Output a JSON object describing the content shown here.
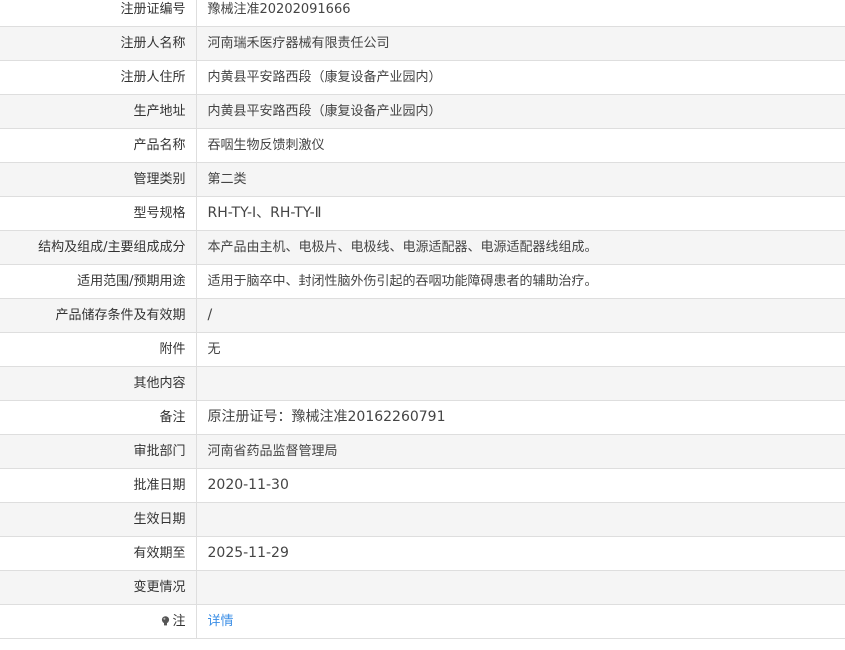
{
  "rows": [
    {
      "label": "注册证编号",
      "value": "豫械注准20202091666"
    },
    {
      "label": "注册人名称",
      "value": "河南瑞禾医疗器械有限责任公司"
    },
    {
      "label": "注册人住所",
      "value": "内黄县平安路西段（康复设备产业园内）"
    },
    {
      "label": "生产地址",
      "value": "内黄县平安路西段（康复设备产业园内）"
    },
    {
      "label": "产品名称",
      "value": "吞咽生物反馈刺激仪"
    },
    {
      "label": "管理类别",
      "value": "第二类"
    },
    {
      "label": "型号规格",
      "value": "RH-TY-Ⅰ、RH-TY-Ⅱ"
    },
    {
      "label": "结构及组成/主要组成成分",
      "value": "本产品由主机、电极片、电极线、电源适配器、电源适配器线组成。"
    },
    {
      "label": "适用范围/预期用途",
      "value": "适用于脑卒中、封闭性脑外伤引起的吞咽功能障碍患者的辅助治疗。"
    },
    {
      "label": "产品储存条件及有效期",
      "value": "/"
    },
    {
      "label": "附件",
      "value": "无"
    },
    {
      "label": "其他内容",
      "value": ""
    },
    {
      "label": "备注",
      "value": "原注册证号：豫械注准20162260791"
    },
    {
      "label": "审批部门",
      "value": "河南省药品监督管理局"
    },
    {
      "label": "批准日期",
      "value": "2020-11-30"
    },
    {
      "label": "生效日期",
      "value": ""
    },
    {
      "label": "有效期至",
      "value": "2025-11-29"
    },
    {
      "label": "变更情况",
      "value": ""
    }
  ],
  "note_row": {
    "label": "注",
    "icon": "lightbulb-icon",
    "link_text": "详情",
    "link_color": "#3a8ee6"
  }
}
